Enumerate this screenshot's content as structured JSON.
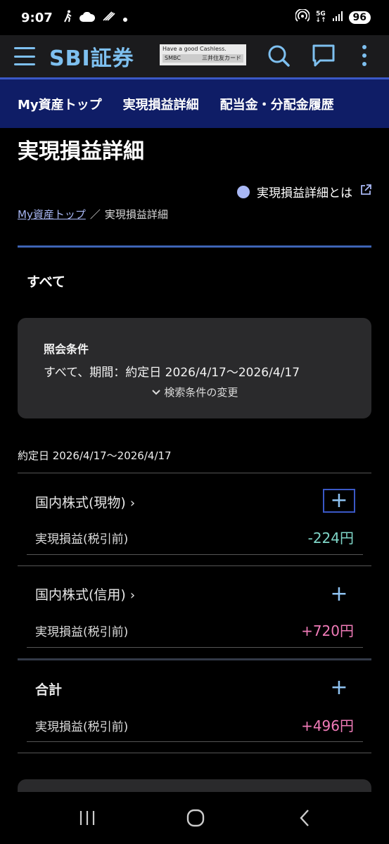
{
  "status_bar": {
    "time": "9:07",
    "network": "5G",
    "battery": "96"
  },
  "header": {
    "brand": "SBI証券",
    "banner_line1": "Have a good Cashless.",
    "banner_line2_left": "SMBC",
    "banner_line2_right": "三井住友カード"
  },
  "nav_tabs": [
    "My資産トップ",
    "実現損益詳細",
    "配当金・分配金履歴"
  ],
  "page": {
    "title": "実現損益詳細",
    "help_link": "実現損益詳細とは",
    "breadcrumb": {
      "home": "My資産トップ",
      "separator": "／",
      "current": "実現損益詳細"
    },
    "filter_label": "すべて"
  },
  "conditions": {
    "title": "照会条件",
    "text": "すべて、期間：約定日 2026/4/17〜2026/4/17",
    "change_label": "検索条件の変更"
  },
  "period": "約定日 2026/4/17〜2026/4/17",
  "sections": [
    {
      "title": "国内株式(現物)",
      "row_label": "実現損益(税引前)",
      "value": "-224円"
    },
    {
      "title": "国内株式(信用)",
      "row_label": "実現損益(税引前)",
      "value": "+720円"
    },
    {
      "title": "合計",
      "row_label": "実現損益(税引前)",
      "value": "+496円"
    }
  ],
  "icons": [
    "walk-icon",
    "cloud-icon",
    "wifi-calling-icon",
    "hotspot-icon",
    "signal-icon",
    "menu-icon",
    "search-icon",
    "chat-icon",
    "more-vertical-icon",
    "external-link-icon",
    "chevron-right-icon",
    "chevron-down-icon",
    "plus-icon"
  ],
  "colors": {
    "nav_bg": "#0f1d66",
    "accent": "#3e64b5",
    "link": "#7ec0f0",
    "negative": "#7fd6c8",
    "positive": "#f07bb8"
  }
}
